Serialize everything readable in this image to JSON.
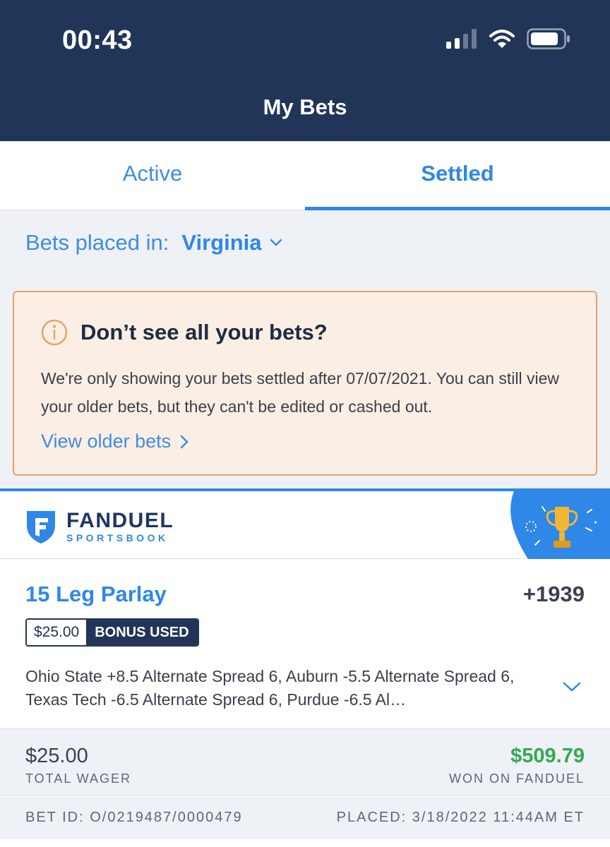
{
  "status_bar": {
    "time": "00:43"
  },
  "header": {
    "title": "My Bets"
  },
  "tabs": [
    {
      "label": "Active",
      "active": false
    },
    {
      "label": "Settled",
      "active": true
    }
  ],
  "filter": {
    "label": "Bets placed in:",
    "state": "Virginia"
  },
  "notice": {
    "title": "Don’t see all your bets?",
    "body": "We're only showing your bets settled after 07/07/2021. You can still view your older bets, but they can't be edited or cashed out.",
    "link": "View older bets"
  },
  "bet": {
    "brand_line1": "FANDUEL",
    "brand_line2": "SPORTSBOOK",
    "name": "15 Leg Parlay",
    "odds": "+1939",
    "bonus_amount": "$25.00",
    "bonus_label": "BONUS USED",
    "legs": "Ohio State +8.5 Alternate Spread 6, Auburn -5.5 Alternate Spread 6, Texas Tech -6.5 Alternate Spread 6, Purdue -6.5 Al…",
    "total_wager": "$25.00",
    "total_wager_label": "TOTAL WAGER",
    "won": "$509.79",
    "won_label": "WON ON FANDUEL",
    "bet_id": "BET ID: O/0219487/0000479",
    "placed": "PLACED: 3/18/2022 11:44AM ET"
  },
  "colors": {
    "navy": "#213558",
    "accent": "#2f87e8",
    "win": "#35a853",
    "notice_bg": "#fbeee4",
    "notice_border": "#e6a36a"
  },
  "icons": [
    "signal-icon",
    "wifi-icon",
    "battery-icon",
    "chevron-down-icon",
    "info-icon",
    "chevron-right-icon",
    "fanduel-shield-icon",
    "trophy-icon"
  ]
}
